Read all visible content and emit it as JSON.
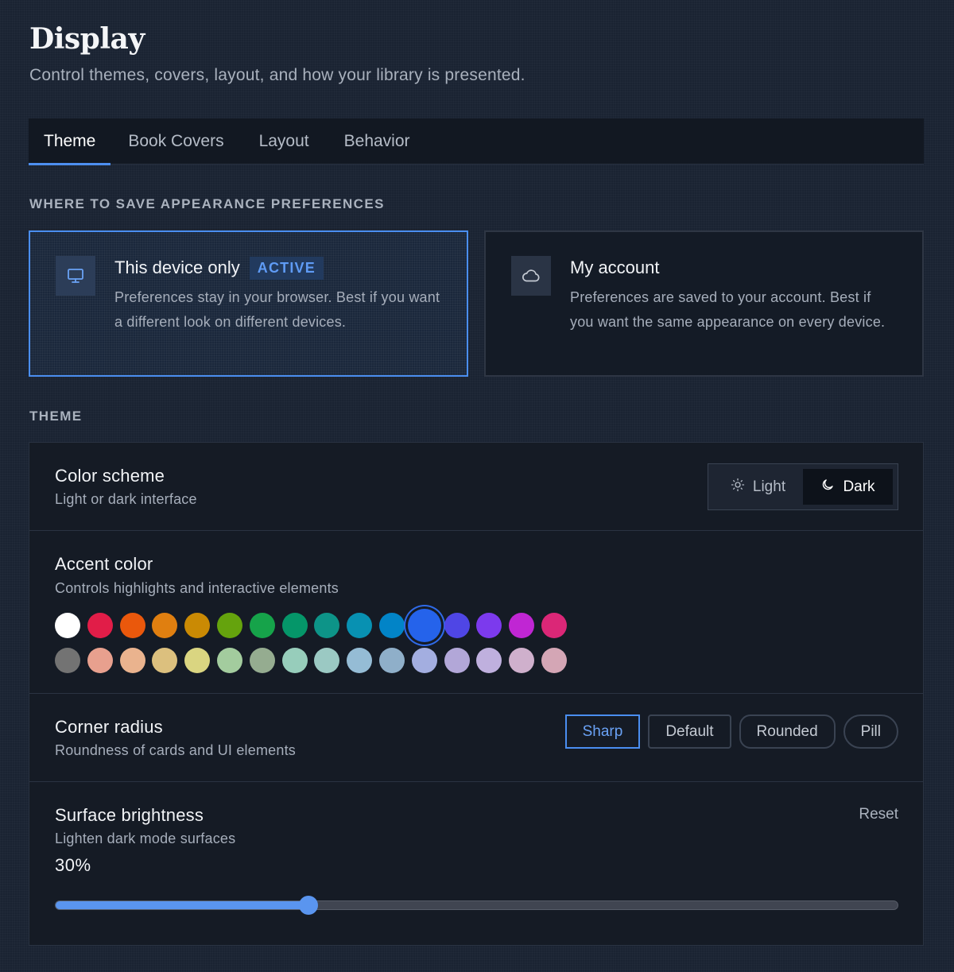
{
  "header": {
    "title": "Display",
    "subtitle": "Control themes, covers, layout, and how your library is presented."
  },
  "tabs": [
    {
      "label": "Theme",
      "active": true
    },
    {
      "label": "Book Covers",
      "active": false
    },
    {
      "label": "Layout",
      "active": false
    },
    {
      "label": "Behavior",
      "active": false
    }
  ],
  "save_prefs": {
    "section_label": "WHERE TO SAVE APPEARANCE PREFERENCES",
    "device": {
      "icon": "monitor-icon",
      "title": "This device only",
      "badge": "ACTIVE",
      "description": "Preferences stay in your browser. Best if you want a different look on different devices."
    },
    "account": {
      "icon": "cloud-icon",
      "title": "My account",
      "description": "Preferences are saved to your account. Best if you want the same appearance on every device."
    }
  },
  "theme": {
    "section_label": "THEME",
    "color_scheme": {
      "title": "Color scheme",
      "description": "Light or dark interface",
      "light_label": "Light",
      "dark_label": "Dark",
      "selected": "Dark"
    },
    "accent": {
      "title": "Accent color",
      "description": "Controls highlights and interactive elements",
      "selected_index": 11,
      "colors_row1": [
        "#ffffff",
        "#e11d48",
        "#ea580c",
        "#e07f10",
        "#ca8a04",
        "#65a30d",
        "#16a34a",
        "#059669",
        "#0d9488",
        "#0891b2",
        "#0284c7",
        "#2563eb",
        "#4f46e5",
        "#7c3aed",
        "#c026d3",
        "#db2777"
      ],
      "colors_row2": [
        "#737373",
        "#e8a08e",
        "#eab38e",
        "#dcc07e",
        "#dad581",
        "#a3cc9e",
        "#95ac90",
        "#97cdbb",
        "#9bc9c3",
        "#95bcd5",
        "#8fafc9",
        "#a3aee0",
        "#b2a7d8",
        "#bfb0de",
        "#cfb0cc",
        "#d4a6b5"
      ]
    },
    "corner_radius": {
      "title": "Corner radius",
      "description": "Roundness of cards and UI elements",
      "options": [
        "Sharp",
        "Default",
        "Rounded",
        "Pill"
      ],
      "selected": "Sharp"
    },
    "surface": {
      "title": "Surface brightness",
      "description": "Lighten dark mode surfaces",
      "value_label": "30%",
      "value": 30,
      "reset_label": "Reset"
    }
  },
  "colors": {
    "accent": "#4a8ef0",
    "background": "#1a2332"
  }
}
